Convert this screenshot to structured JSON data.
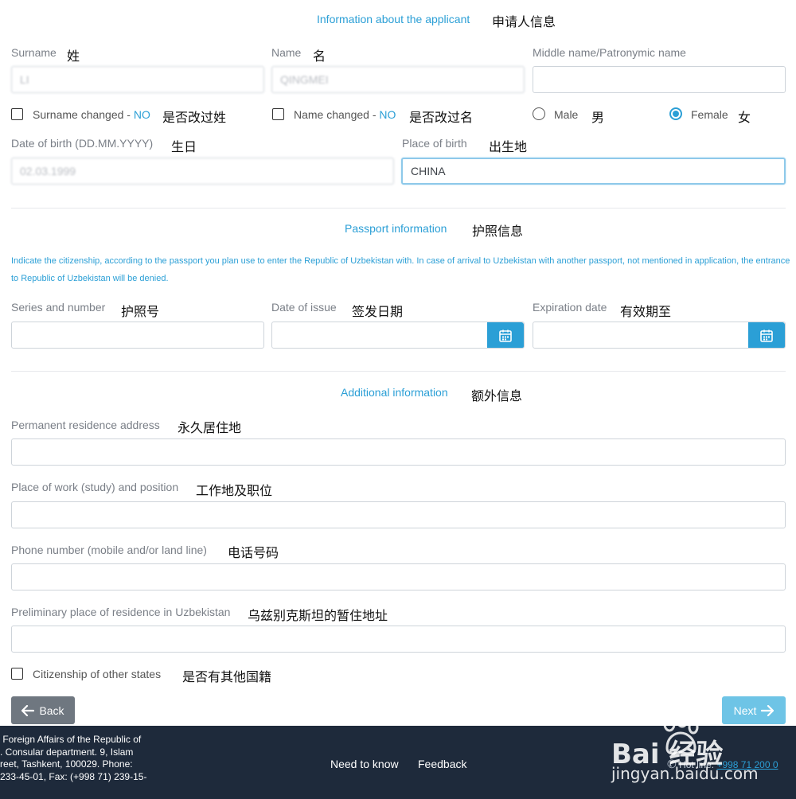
{
  "applicant": {
    "section_title": "Information about the applicant",
    "section_cn": "申请人信息",
    "surname": {
      "label": "Surname",
      "cn": "姓",
      "value": "LI"
    },
    "name": {
      "label": "Name",
      "cn": "名",
      "value": "QINGMEI"
    },
    "middle_name": {
      "label": "Middle name/Patronymic name",
      "value": ""
    },
    "surname_changed": {
      "label": "Surname changed - ",
      "state": "NO",
      "cn": "是否改过姓"
    },
    "name_changed": {
      "label": "Name changed - ",
      "state": "NO",
      "cn": "是否改过名"
    },
    "gender": {
      "male": "Male",
      "male_cn": "男",
      "female": "Female",
      "female_cn": "女",
      "selected": "Female"
    },
    "dob": {
      "label": "Date of birth (DD.MM.YYYY)",
      "cn": "生日",
      "value": "02.03.1999"
    },
    "pob": {
      "label": "Place of birth",
      "cn": "出生地",
      "value": "CHINA"
    }
  },
  "passport": {
    "section_title": "Passport information",
    "section_cn": "护照信息",
    "note": "Indicate the citizenship, according to the passport you plan use to enter the Republic of Uzbekistan with. In case of arrival to Uzbekistan with another passport, not mentioned in application, the entrance to Republic of Uzbekistan will be denied.",
    "series": {
      "label": "Series and number",
      "cn": "护照号",
      "value": ""
    },
    "issue": {
      "label": "Date of issue",
      "cn": "签发日期",
      "value": ""
    },
    "expiry": {
      "label": "Expiration date",
      "cn": "有效期至",
      "value": ""
    },
    "calendar_icon": "calendar-icon"
  },
  "additional": {
    "section_title": "Additional information",
    "section_cn": "额外信息",
    "residence": {
      "label": "Permanent residence address",
      "cn": "永久居住地",
      "value": ""
    },
    "work": {
      "label": "Place of work (study) and position",
      "cn": "工作地及职位",
      "value": ""
    },
    "phone": {
      "label": "Phone number (mobile and/or land line)",
      "cn": "电话号码",
      "value": ""
    },
    "uz_residence": {
      "label": "Preliminary place of residence in Uzbekistan",
      "cn": "乌兹别克斯坦的暂住地址",
      "value": ""
    },
    "citizenship": {
      "label": "Citizenship of other states",
      "cn": "是否有其他国籍"
    }
  },
  "actions": {
    "back": "Back",
    "next": "Next"
  },
  "footer": {
    "address": " Foreign Affairs of the Republic of\n. Consular department. 9, Islam\nreet, Tashkent, 100029. Phone:\n233-45-01, Fax: (+998 71) 239-15-",
    "need_to_know": "Need to know",
    "feedback": "Feedback",
    "hotline_label": "Hot line: ",
    "hotline_number": "+998 71 200 0"
  },
  "watermark": {
    "brand": "Bai  经验",
    "url": "jingyan.baidu.com"
  },
  "colors": {
    "accent": "#2b9fd6",
    "footer_bg": "#1e2a3b",
    "back_btn": "#6f7780",
    "next_btn": "#6ec4e6"
  }
}
